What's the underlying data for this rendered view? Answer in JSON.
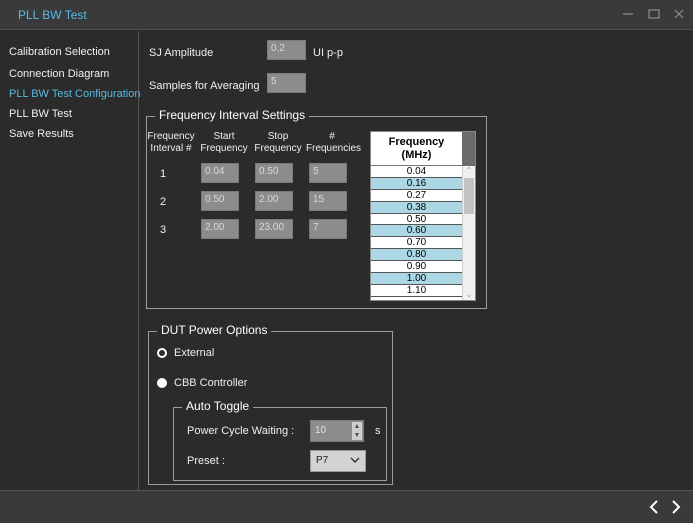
{
  "window": {
    "title": "PLL BW Test"
  },
  "sidebar": {
    "items": [
      {
        "label": "Calibration Selection"
      },
      {
        "label": "Connection Diagram"
      },
      {
        "label": "PLL BW Test Configuration"
      },
      {
        "label": "PLL BW Test"
      },
      {
        "label": "Save Results"
      }
    ],
    "active_index": 2
  },
  "sj_amplitude": {
    "label": "SJ Amplitude",
    "value": "0.2",
    "unit": "UI p-p"
  },
  "samples": {
    "label": "Samples for Averaging",
    "value": "5"
  },
  "freq_interval": {
    "legend": "Frequency Interval Settings",
    "headers": {
      "interval_l1": "Frequency",
      "interval_l2": "Interval #",
      "start_l1": "Start",
      "start_l2": "Frequency",
      "stop_l1": "Stop",
      "stop_l2": "Frequency",
      "count_l1": "#",
      "count_l2": "Frequencies"
    },
    "rows": [
      {
        "index": "1",
        "start": "0.04",
        "stop": "0.50",
        "count": "5"
      },
      {
        "index": "2",
        "start": "0.50",
        "stop": "2.00",
        "count": "15"
      },
      {
        "index": "3",
        "start": "2.00",
        "stop": "23.00",
        "count": "7"
      }
    ],
    "list_header_l1": "Frequency",
    "list_header_l2": "(MHz)",
    "list_values": [
      "0.04",
      "0.16",
      "0.27",
      "0.38",
      "0.50",
      "0.60",
      "0.70",
      "0.80",
      "0.90",
      "1.00",
      "1.10"
    ]
  },
  "dut_power": {
    "legend": "DUT Power Options",
    "external_label": "External",
    "cbb_label": "CBB Controller",
    "selected": "CBB Controller",
    "auto_toggle": {
      "legend": "Auto Toggle",
      "power_cycle_label": "Power Cycle Waiting :",
      "power_cycle_value": "10",
      "power_cycle_unit": "s",
      "preset_label": "Preset :",
      "preset_value": "P7"
    }
  },
  "colors": {
    "accent": "#58b9e3",
    "background": "#2b2b2b",
    "list_alt_row": "#acd7e5"
  },
  "icons": {
    "minimize": "minimize-icon",
    "maximize": "maximize-icon",
    "close": "close-icon",
    "prev": "chevron-left-icon",
    "next": "chevron-right-icon"
  }
}
